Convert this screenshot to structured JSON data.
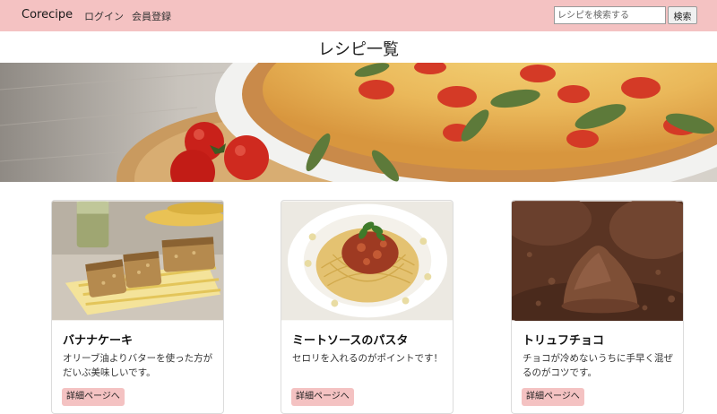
{
  "header": {
    "brand": "Corecipe",
    "nav": [
      {
        "label": "ログイン"
      },
      {
        "label": "会員登録"
      }
    ],
    "search": {
      "placeholder": "レシピを検索する",
      "button_label": "検索"
    },
    "background_color": "#f4c2c2"
  },
  "page": {
    "title": "レシピ一覧"
  },
  "recipes": [
    {
      "title": "バナナケーキ",
      "description": "オリーブ油よりバターを使った方がだいぶ美味しいです。",
      "button_label": "詳細ページへ",
      "image": "banana-cake-photo"
    },
    {
      "title": "ミートソースのパスタ",
      "description": "セロリを入れるのがポイントです！",
      "button_label": "詳細ページへ",
      "image": "meat-sauce-pasta-photo"
    },
    {
      "title": "トリュフチョコ",
      "description": "チョコが冷めないうちに手早く混ぜるのがコツです。",
      "button_label": "詳細ページへ",
      "image": "truffle-chocolate-photo"
    }
  ],
  "colors": {
    "accent": "#f4c2c2"
  }
}
